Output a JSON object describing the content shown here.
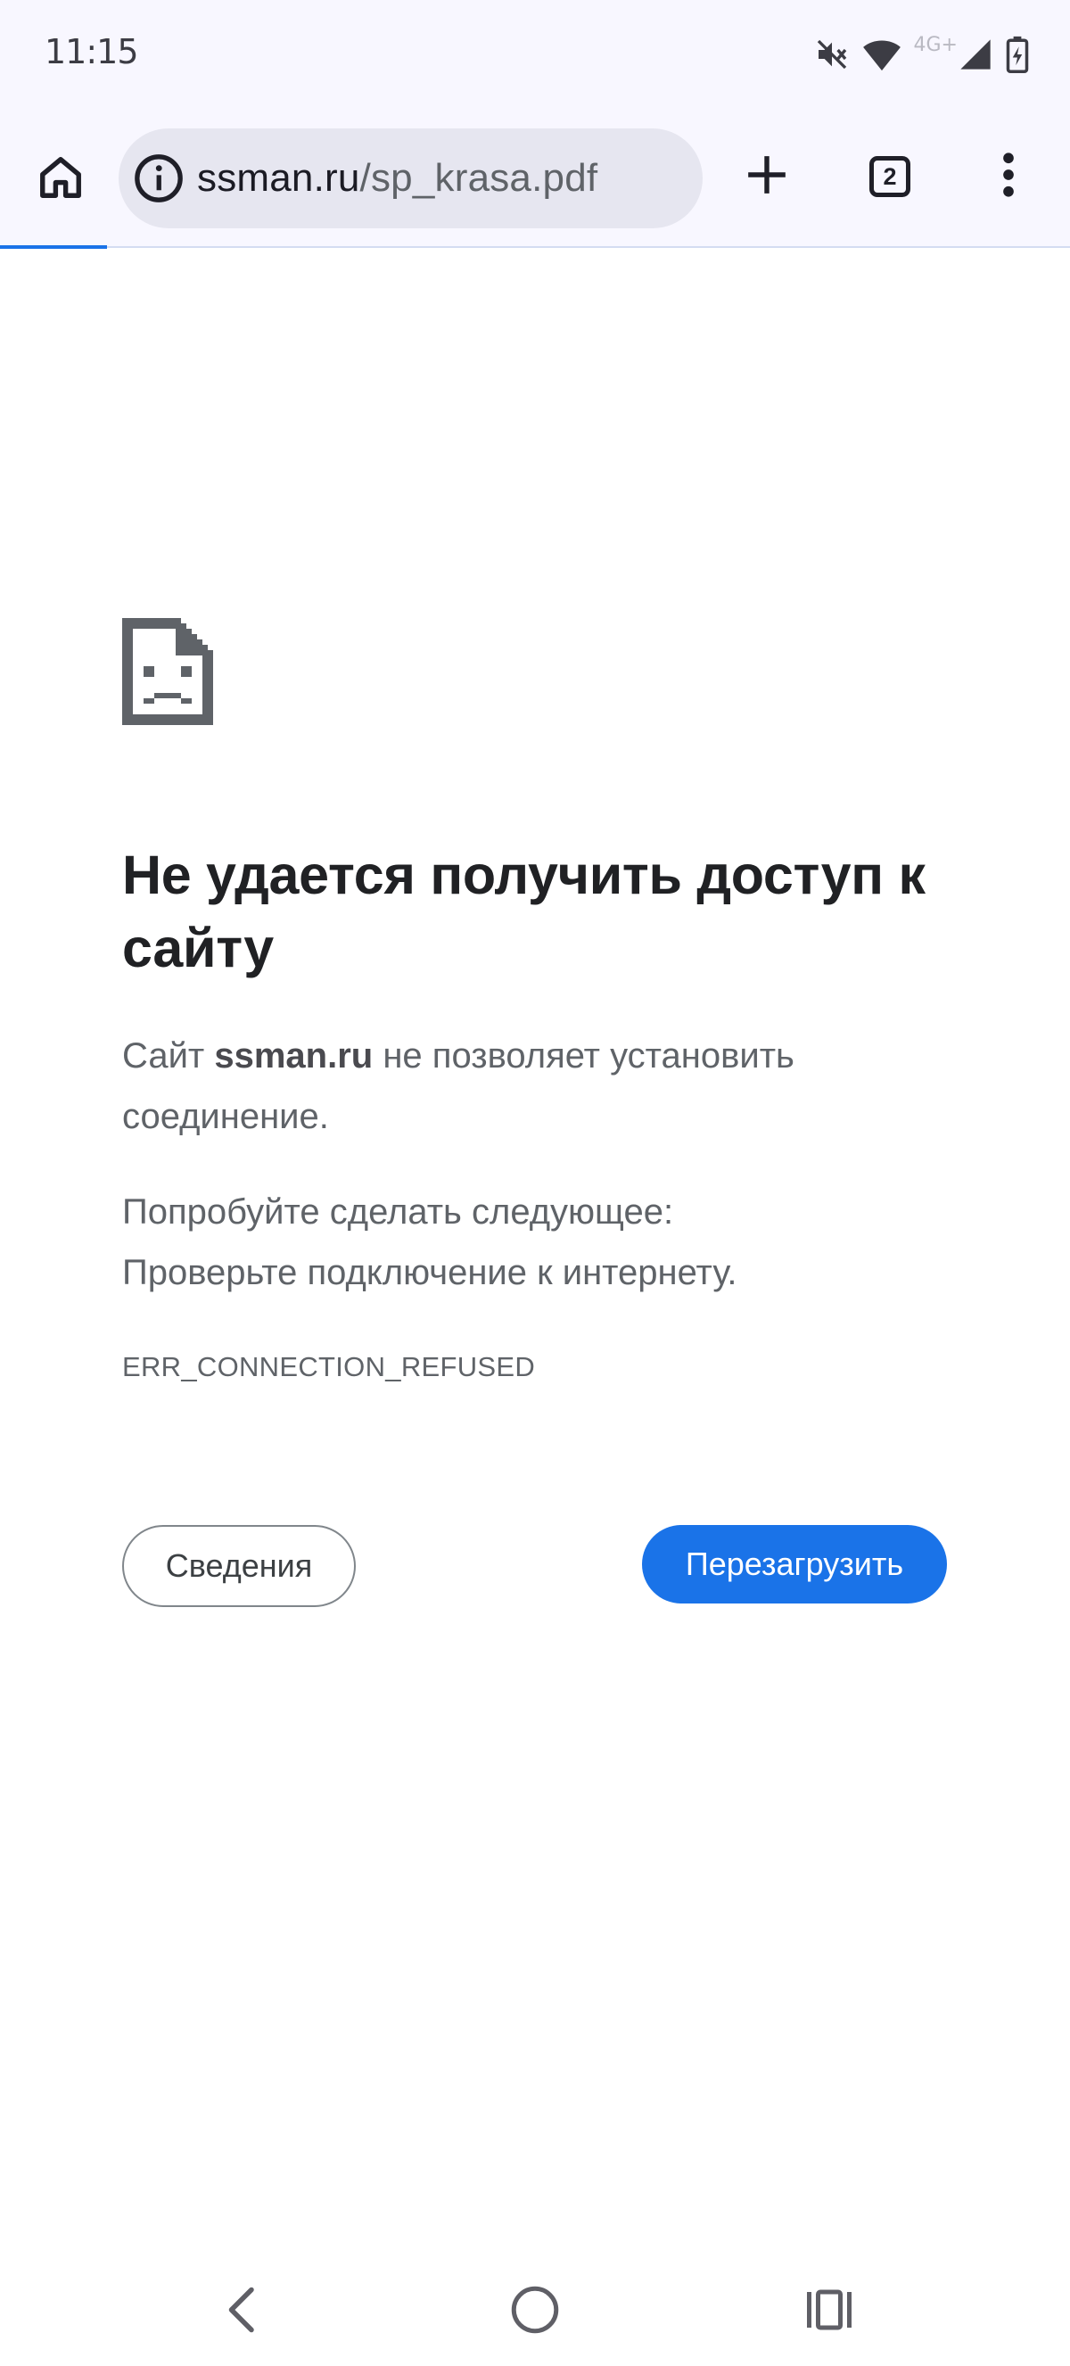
{
  "status_bar": {
    "time": "11:15",
    "network_label": "4G+",
    "icons": [
      "mute-icon",
      "wifi-icon",
      "signal-icon",
      "battery-icon"
    ]
  },
  "toolbar": {
    "url_host": "ssman.ru",
    "url_path": "/sp_krasa.pdf",
    "tab_count": "2",
    "icons": [
      "home-icon",
      "info-icon",
      "plus-icon",
      "tabs-icon",
      "more-vert-icon"
    ]
  },
  "error": {
    "icon": "sad-page-icon",
    "title": "Не удается получить доступ к сайту",
    "desc_prefix": "Сайт ",
    "desc_host": "ssman.ru",
    "desc_suffix": " не позволяет установить соединение.",
    "suggest_heading": "Попробуйте сделать следующее:",
    "suggest_item": "Проверьте подключение к интернету.",
    "code": "ERR_CONNECTION_REFUSED"
  },
  "buttons": {
    "details": "Сведения",
    "reload": "Перезагрузить"
  },
  "colors": {
    "accent": "#1a73e8",
    "toolbar_bg": "#f8f7ff",
    "omnibox_bg": "#e6e6f0"
  },
  "nav": {
    "icons": [
      "back-icon",
      "home-circle-icon",
      "recents-icon"
    ]
  }
}
